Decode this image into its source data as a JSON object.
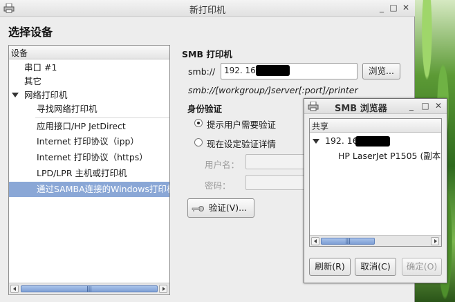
{
  "window": {
    "title": "新打印机",
    "minimize": "_",
    "maximize": "□",
    "close": "✕"
  },
  "heading": "选择设备",
  "device_tree": {
    "header": "设备",
    "items": [
      {
        "label": "串口 #1"
      },
      {
        "label": "其它"
      },
      {
        "label": "网络打印机"
      },
      {
        "label": "寻找网络打印机"
      },
      {
        "label": "应用接口/HP JetDirect"
      },
      {
        "label": "Internet 打印协议（ipp）"
      },
      {
        "label": "Internet 打印协议（https）"
      },
      {
        "label": "LPD/LPR 主机或打印机"
      },
      {
        "label": "通过SAMBA连接的Windows打印机"
      }
    ],
    "scroll_grip": "|||"
  },
  "smb": {
    "section_title": "SMB 打印机",
    "prefix_label": "smb://",
    "url_value": "192. 168.",
    "browse_button": "浏览...",
    "hint": "smb://[workgroup/]server[:port]/printer"
  },
  "auth": {
    "title": "身份验证",
    "option_prompt": "提示用户需要验证",
    "option_now": "现在设定验证详情",
    "username_label": "用户名：",
    "password_label": "密码：",
    "verify_button": "验证(V)..."
  },
  "smb_browser": {
    "title": "SMB 浏览器",
    "minimize": "_",
    "maximize": "□",
    "close": "✕",
    "header": "共享",
    "host": "192. 168.",
    "printer": "HP LaserJet P1505 (副本",
    "scroll_grip": "|||",
    "refresh_button": "刷新(R)",
    "cancel_button": "取消(C)",
    "ok_button": "确定(O)"
  }
}
